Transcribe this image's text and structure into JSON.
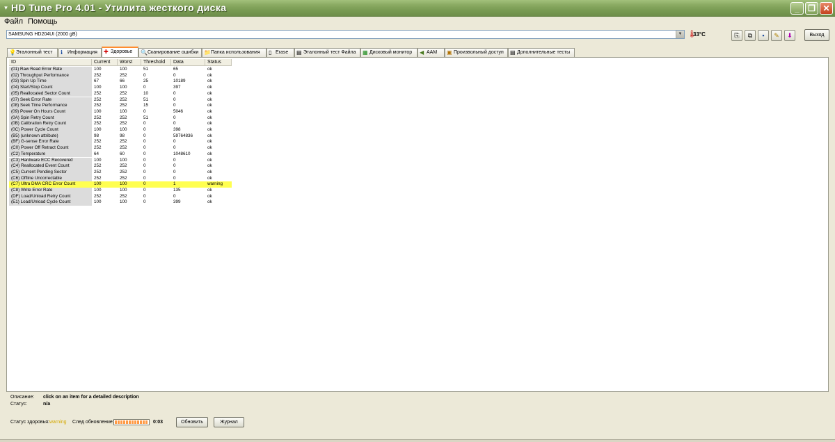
{
  "window": {
    "title": "HD Tune Pro 4.01 - Утилита жесткого диска",
    "minimize": "_",
    "maximize": "❐",
    "close": "✕"
  },
  "menu": [
    "Файл",
    "Помощь"
  ],
  "toolbar": {
    "drive": "SAMSUNG HD204UI (2000 gB)",
    "temperature": "33°C",
    "exit_label": "Выход",
    "icons": [
      "copy-text-icon",
      "copy-screen-icon",
      "save-icon",
      "options-icon",
      "download-icon"
    ]
  },
  "tabs": [
    {
      "label": "Эталонный тест",
      "icon": "benchmark-icon",
      "glyph": "💡"
    },
    {
      "label": "Информация",
      "icon": "info-icon",
      "glyph": "ℹ"
    },
    {
      "label": "Здоровье",
      "icon": "health-icon",
      "glyph": "✚",
      "active": true
    },
    {
      "label": "Сканирование ошибки",
      "icon": "error-scan-icon",
      "glyph": "🔍"
    },
    {
      "label": "Папка использования",
      "icon": "folder-icon",
      "glyph": "📁"
    },
    {
      "label": "Erase",
      "icon": "erase-icon",
      "glyph": "▯"
    },
    {
      "label": "Эталонный тест Файла",
      "icon": "file-benchmark-icon",
      "glyph": "▤"
    },
    {
      "label": "Дисковый монитор",
      "icon": "disk-monitor-icon",
      "glyph": "▦"
    },
    {
      "label": "AAM",
      "icon": "aam-icon",
      "glyph": "◀"
    },
    {
      "label": "Произвольный доступ",
      "icon": "random-access-icon",
      "glyph": "▣"
    },
    {
      "label": "Дополнительные тесты",
      "icon": "extra-tests-icon",
      "glyph": "▤"
    }
  ],
  "table": {
    "headers": [
      "ID",
      "Current",
      "Worst",
      "Threshold",
      "Data",
      "Status"
    ],
    "rows": [
      [
        "(01) Raw Read Error Rate",
        "100",
        "100",
        "51",
        "65",
        "ok"
      ],
      [
        "(02) Throughput Performance",
        "252",
        "252",
        "0",
        "0",
        "ok"
      ],
      [
        "(03) Spin Up Time",
        "67",
        "66",
        "25",
        "10189",
        "ok"
      ],
      [
        "(04) Start/Stop Count",
        "100",
        "100",
        "0",
        "397",
        "ok"
      ],
      [
        "(05) Reallocated Sector Count",
        "252",
        "252",
        "10",
        "0",
        "ok"
      ],
      [
        "(07) Seek Error Rate",
        "252",
        "252",
        "51",
        "0",
        "ok"
      ],
      [
        "(08) Seek Time Performance",
        "252",
        "252",
        "15",
        "0",
        "ok"
      ],
      [
        "(09) Power On Hours Count",
        "100",
        "100",
        "0",
        "5046",
        "ok"
      ],
      [
        "(0A) Spin Retry Count",
        "252",
        "252",
        "51",
        "0",
        "ok"
      ],
      [
        "(0B) Calibration Retry Count",
        "252",
        "252",
        "0",
        "0",
        "ok"
      ],
      [
        "(0C) Power Cycle Count",
        "100",
        "100",
        "0",
        "398",
        "ok"
      ],
      [
        "(B5) (unknown attribute)",
        "98",
        "98",
        "0",
        "59764836",
        "ok"
      ],
      [
        "(BF) G-sense Error Rate",
        "252",
        "252",
        "0",
        "0",
        "ok"
      ],
      [
        "(C0) Power Off Retract Count",
        "252",
        "252",
        "0",
        "0",
        "ok"
      ],
      [
        "(C2) Temperature",
        "64",
        "60",
        "0",
        "1048610",
        "ok"
      ],
      [
        "(C3) Hardware ECC Recovered",
        "100",
        "100",
        "0",
        "0",
        "ok"
      ],
      [
        "(C4) Reallocated Event Count",
        "252",
        "252",
        "0",
        "0",
        "ok"
      ],
      [
        "(C5) Current Pending Sector",
        "252",
        "252",
        "0",
        "0",
        "ok"
      ],
      [
        "(C6) Offline Uncorrectable",
        "252",
        "252",
        "0",
        "0",
        "ok"
      ],
      [
        "(C7) Ultra DMA CRC Error Count",
        "100",
        "100",
        "0",
        "1",
        "warning"
      ],
      [
        "(C8) Write Error Rate",
        "100",
        "100",
        "0",
        "135",
        "ok"
      ],
      [
        "(DF) Load/Unload Retry Count",
        "252",
        "252",
        "0",
        "0",
        "ok"
      ],
      [
        "(E1) Load/Unload Cycle Count",
        "100",
        "100",
        "0",
        "399",
        "ok"
      ]
    ],
    "warning_color": "#ffff50"
  },
  "details": {
    "description_label": "Описание:",
    "description_value": "click on an item for a detailed description",
    "status_label": "Статус:",
    "status_value": "n/a"
  },
  "health": {
    "label": "Статус здоровья:",
    "value": "warning",
    "next_update_label": "След обновление:",
    "progress_fraction": 1.0,
    "time_left": "0:03",
    "refresh_label": "Обновить",
    "log_label": "Журнал",
    "warning_text_color": "#d4a800"
  }
}
